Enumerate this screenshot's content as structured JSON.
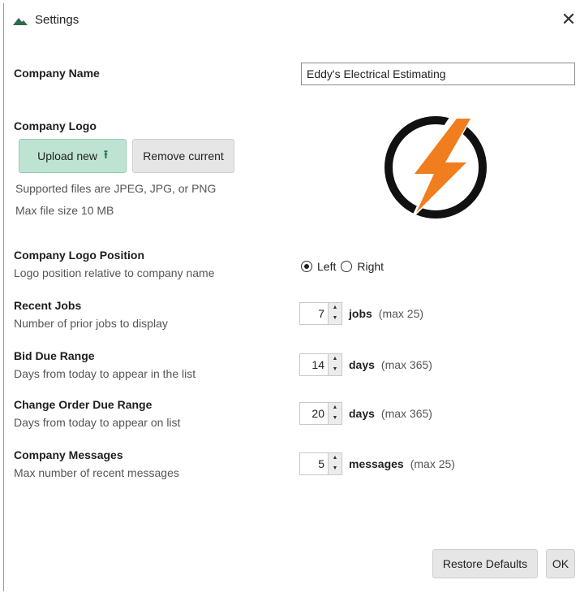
{
  "window": {
    "title": "Settings",
    "close_glyph": "✕"
  },
  "company_name": {
    "label": "Company Name",
    "value": "Eddy's Electrical Estimating"
  },
  "company_logo": {
    "label": "Company Logo",
    "upload_label": "Upload new",
    "upload_icon": "upload-arrow-icon",
    "remove_label": "Remove current",
    "supported_note": "Supported files are JPEG, JPG, or PNG",
    "size_note": "Max file size 10 MB"
  },
  "logo_position": {
    "label": "Company Logo Position",
    "description": "Logo position relative to company name",
    "options": [
      "Left",
      "Right"
    ],
    "selected": "Left"
  },
  "recent_jobs": {
    "label": "Recent Jobs",
    "description": "Number of prior jobs to display",
    "value": "7",
    "unit": "jobs",
    "max_note": "(max 25)"
  },
  "bid_due_range": {
    "label": "Bid Due Range",
    "description": "Days from today to appear in the list",
    "value": "14",
    "unit": "days",
    "max_note": "(max 365)"
  },
  "change_order_due_range": {
    "label": "Change Order Due Range",
    "description": "Days from today to appear on list",
    "value": "20",
    "unit": "days",
    "max_note": "(max 365)"
  },
  "company_messages": {
    "label": "Company Messages",
    "description": "Max number of recent messages",
    "value": "5",
    "unit": "messages",
    "max_note": "(max 25)"
  },
  "footer": {
    "restore_label": "Restore Defaults",
    "ok_label": "OK"
  },
  "colors": {
    "accent_green": "#bfe3d2",
    "logo_orange": "#f07d1e",
    "logo_ring": "#111111"
  }
}
